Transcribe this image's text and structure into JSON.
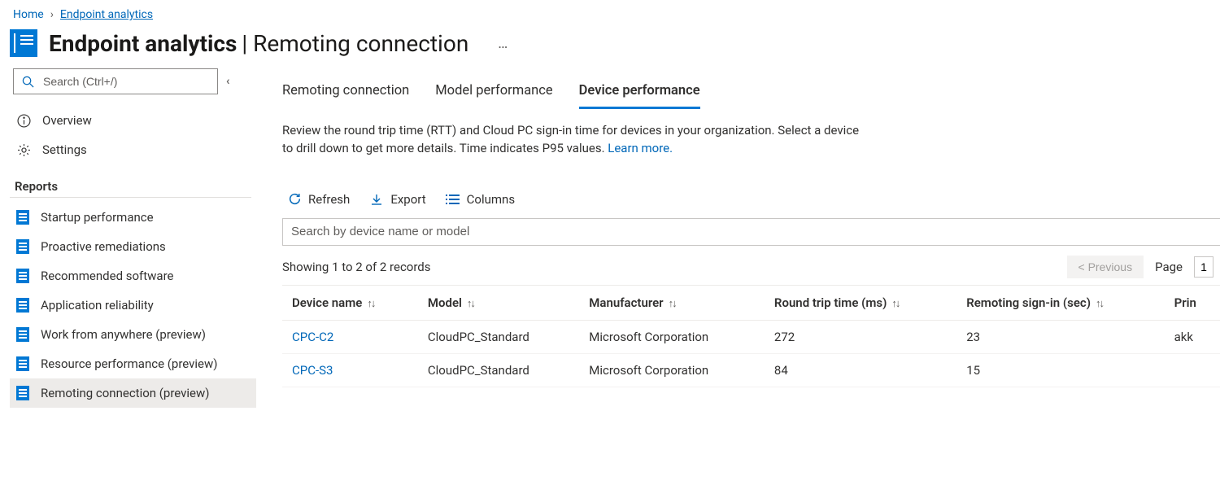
{
  "breadcrumb": {
    "home": "Home",
    "current": "Endpoint analytics"
  },
  "header": {
    "title_bold": "Endpoint analytics",
    "title_light": "| Remoting connection",
    "more": "…"
  },
  "sidebar": {
    "search_placeholder": "Search (Ctrl+/)",
    "overview": "Overview",
    "settings": "Settings",
    "reports_header": "Reports",
    "items": [
      {
        "label": "Startup performance"
      },
      {
        "label": "Proactive remediations"
      },
      {
        "label": "Recommended software"
      },
      {
        "label": "Application reliability"
      },
      {
        "label": "Work from anywhere (preview)"
      },
      {
        "label": "Resource performance (preview)"
      },
      {
        "label": "Remoting connection (preview)"
      }
    ]
  },
  "tabs": {
    "remoting": "Remoting connection",
    "model": "Model performance",
    "device": "Device performance"
  },
  "description": {
    "text": "Review the round trip time (RTT) and Cloud PC sign-in time for devices in your organization. Select a device to drill down to get more details. Time indicates P95 values. ",
    "learn_more": "Learn more."
  },
  "toolbar": {
    "refresh": "Refresh",
    "export": "Export",
    "columns": "Columns"
  },
  "table_search_placeholder": "Search by device name or model",
  "records_summary": "Showing 1 to 2 of 2 records",
  "pager": {
    "previous": "<  Previous",
    "page_label": "Page",
    "page_value": "1"
  },
  "columns": {
    "device": "Device name",
    "model": "Model",
    "manufacturer": "Manufacturer",
    "rtt": "Round trip time (ms)",
    "signin": "Remoting sign-in (sec)",
    "primary": "Prin"
  },
  "chart_data": {
    "type": "table",
    "columns": [
      "Device name",
      "Model",
      "Manufacturer",
      "Round trip time (ms)",
      "Remoting sign-in (sec)",
      "Primary"
    ],
    "rows": [
      {
        "device": "CPC-C2",
        "model": "CloudPC_Standard",
        "manufacturer": "Microsoft Corporation",
        "rtt": 272,
        "signin": 23,
        "primary": "akk"
      },
      {
        "device": "CPC-S3",
        "model": "CloudPC_Standard",
        "manufacturer": "Microsoft Corporation",
        "rtt": 84,
        "signin": 15,
        "primary": ""
      }
    ]
  }
}
